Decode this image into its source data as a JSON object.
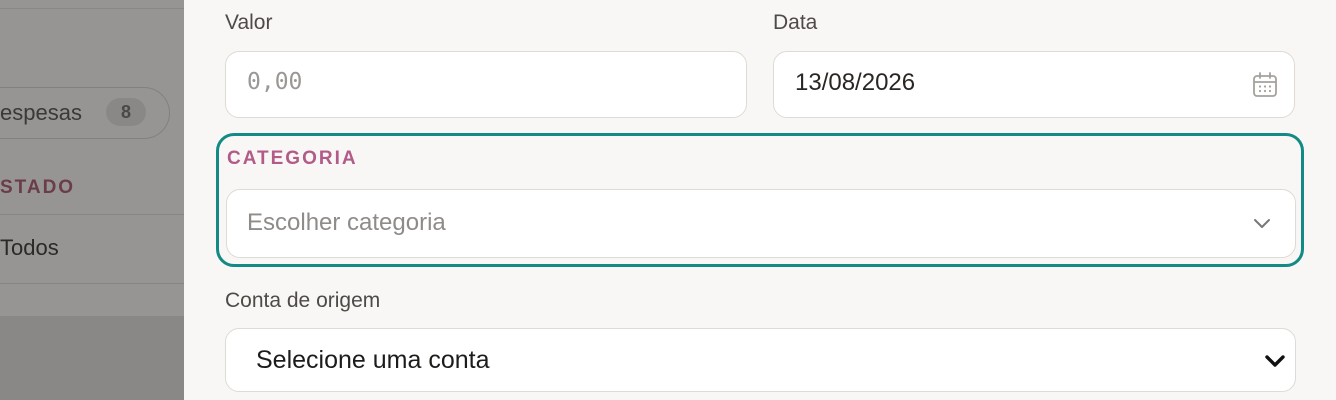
{
  "background": {
    "filter_pill": {
      "label": "espesas",
      "count": "8"
    },
    "section_title": "STADO",
    "filter_option": "Todos"
  },
  "form": {
    "amount": {
      "label": "Valor",
      "value": "",
      "placeholder": "0,00"
    },
    "date": {
      "label": "Data",
      "value": "13/08/2026",
      "icon": "calendar-icon"
    },
    "category": {
      "label": "CATEGORIA",
      "placeholder": "Escolher categoria",
      "icon": "chevron-down-icon"
    },
    "source_account": {
      "label": "Conta de origem",
      "selected": "Selecione uma conta",
      "icon": "chevron-down-icon"
    }
  },
  "colors": {
    "focus_ring": "#128a86",
    "category_label": "#b25b88",
    "drawer_background": "#f9f7f5"
  }
}
